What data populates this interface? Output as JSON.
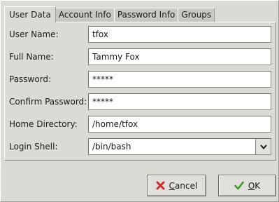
{
  "tabs": [
    {
      "label": "User Data",
      "active": true
    },
    {
      "label": "Account Info",
      "active": false
    },
    {
      "label": "Password Info",
      "active": false
    },
    {
      "label": "Groups",
      "active": false
    }
  ],
  "form": {
    "user_name": {
      "label": "User Name:",
      "value": "tfox"
    },
    "full_name": {
      "label": "Full Name:",
      "value": "Tammy Fox"
    },
    "password": {
      "label": "Password:",
      "value": "*****"
    },
    "confirm_password": {
      "label": "Confirm Password:",
      "value": "*****"
    },
    "home_directory": {
      "label": "Home Directory:",
      "value": "/home/tfox"
    },
    "login_shell": {
      "label": "Login Shell:",
      "value": "/bin/bash"
    }
  },
  "buttons": {
    "cancel": {
      "mnemonic": "C",
      "rest": "ancel",
      "icon": "cancel-x-icon"
    },
    "ok": {
      "mnemonic": "O",
      "rest": "K",
      "icon": "checkmark-icon"
    }
  },
  "colors": {
    "cancel_icon": "#d6282b",
    "ok_icon": "#3c9a2b"
  }
}
